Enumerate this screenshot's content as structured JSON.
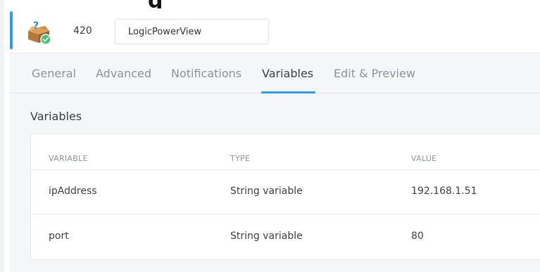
{
  "header": {
    "device_id": "420",
    "device_name": "LogicPowerView"
  },
  "tabs": [
    {
      "label": "General",
      "active": false
    },
    {
      "label": "Advanced",
      "active": false
    },
    {
      "label": "Notifications",
      "active": false
    },
    {
      "label": "Variables",
      "active": true
    },
    {
      "label": "Edit & Preview",
      "active": false
    }
  ],
  "section": {
    "title": "Variables"
  },
  "table": {
    "columns": [
      "VARIABLE",
      "TYPE",
      "VALUE"
    ],
    "rows": [
      {
        "variable": "ipAddress",
        "type": "String variable",
        "value": "192.168.1.51"
      },
      {
        "variable": "port",
        "type": "String variable",
        "value": "80"
      }
    ]
  },
  "colors": {
    "accent": "#2f9bf0",
    "status_ok": "#3cc36a",
    "background": "#f4f6f8"
  },
  "icons": {
    "device": "question-box-icon",
    "status": "checkmark-circle-icon"
  }
}
